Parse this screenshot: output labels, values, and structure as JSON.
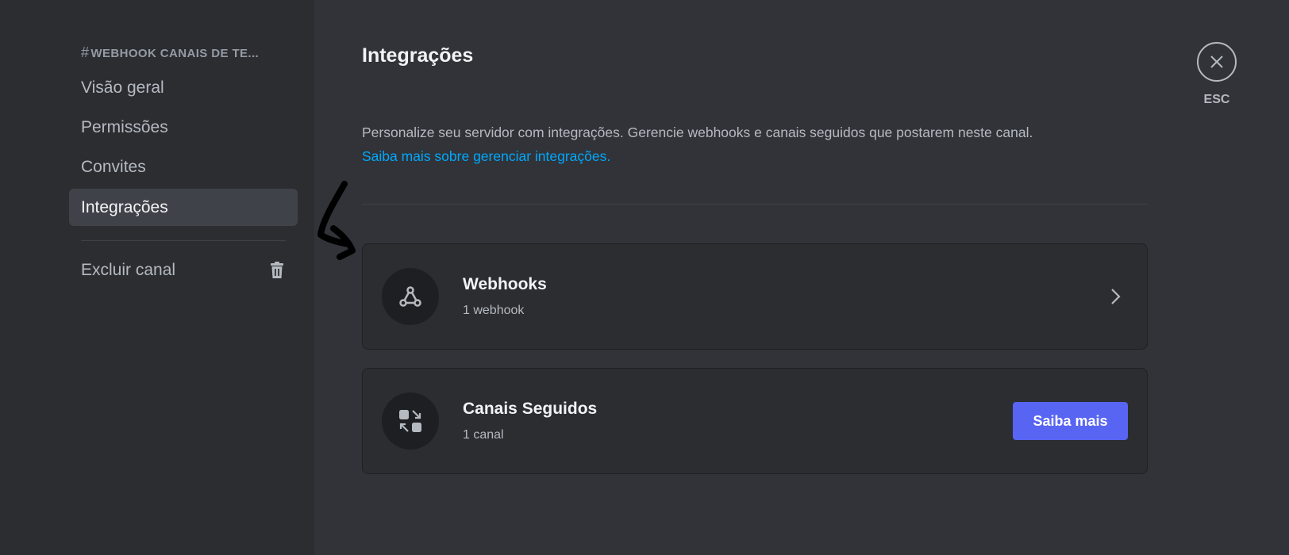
{
  "sidebar": {
    "header_hash": "#",
    "header": "WEBHOOK CANAIS DE TE...",
    "items": [
      {
        "label": "Visão geral"
      },
      {
        "label": "Permissões"
      },
      {
        "label": "Convites"
      },
      {
        "label": "Integrações",
        "active": true
      }
    ],
    "delete_label": "Excluir canal"
  },
  "main": {
    "title": "Integrações",
    "description": "Personalize seu servidor com integrações. Gerencie webhooks e canais seguidos que postarem neste canal.",
    "learn_link": "Saiba mais sobre gerenciar integrações.",
    "cards": [
      {
        "title": "Webhooks",
        "subtitle": "1 webhook",
        "icon": "webhook-icon",
        "action": "chevron-right-icon"
      },
      {
        "title": "Canais Seguidos",
        "subtitle": "1 canal",
        "icon": "follow-channels-icon",
        "button_label": "Saiba mais"
      }
    ]
  },
  "close": {
    "label": "ESC",
    "icon": "close-icon"
  },
  "colors": {
    "background": "#313338",
    "sidebar": "#2b2d31",
    "active_item": "#404249",
    "link": "#00a8fc",
    "button": "#5865f2"
  }
}
